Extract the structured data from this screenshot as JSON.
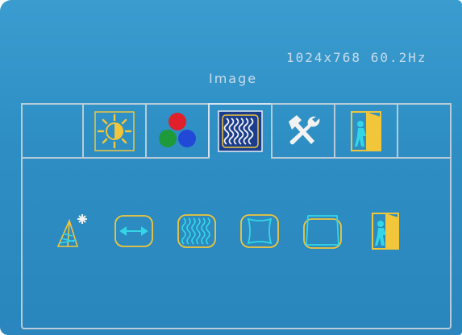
{
  "status": {
    "resolution": "1024x768 60.2Hz"
  },
  "menu": {
    "title": "Image"
  },
  "tabs": [
    {
      "icon": "blank-tab"
    },
    {
      "icon": "brightness-contrast-icon"
    },
    {
      "icon": "color-icon"
    },
    {
      "icon": "image-icon",
      "active": true
    },
    {
      "icon": "tools-icon"
    },
    {
      "icon": "exit-icon"
    },
    {
      "icon": "blank-tab"
    }
  ],
  "submenu_items": [
    {
      "icon": "sharpness-icon"
    },
    {
      "icon": "horizontal-size-icon"
    },
    {
      "icon": "moire-icon"
    },
    {
      "icon": "pincushion-icon"
    },
    {
      "icon": "trapezoid-icon"
    },
    {
      "icon": "exit-icon"
    }
  ],
  "colors": {
    "background": "#2e8fc4",
    "text": "#c9dbea",
    "icon_yellow": "#f2c63a",
    "icon_cyan": "#33d6e6",
    "active_tab_fill": "#1b3d8c"
  }
}
